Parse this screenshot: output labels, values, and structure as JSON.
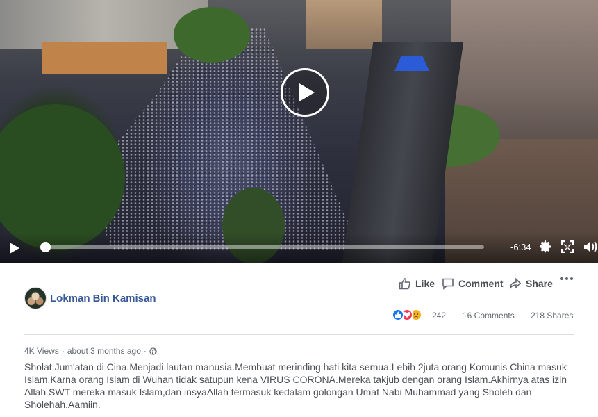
{
  "video": {
    "remaining_time": "-6:34",
    "progress": 0.0
  },
  "post": {
    "author": "Lokman Bin Kamisan",
    "actions": {
      "like_label": "Like",
      "comment_label": "Comment",
      "share_label": "Share"
    },
    "reactions": {
      "icons": [
        "like-reaction",
        "love-reaction",
        "sad-reaction"
      ],
      "count": "242"
    },
    "comments_text": "16 Comments",
    "shares_text": "218 Shares",
    "views": "4K Views",
    "separator": "·",
    "time_ago": "about 3 months ago",
    "caption": "Sholat Jum'atan di Cina.Menjadi lautan manusia.Membuat merinding hati kita semua.Lebih 2juta orang Komunis China masuk Islam.Karna orang Islam di Wuhan tidak satupun kena VIRUS CORONA.Mereka takjub dengan orang Islam.Akhirnya atas izin Allah SWT mereka masuk Islam,dan insyaAllah termasuk kedalam golongan Umat Nabi Muhammad yang Sholeh dan Sholehah.Aamiin."
  },
  "colors": {
    "author_link": "#385898",
    "like_blue": "#1877f2",
    "love_red": "#f33e58",
    "sad_yellow": "#f7b125"
  }
}
